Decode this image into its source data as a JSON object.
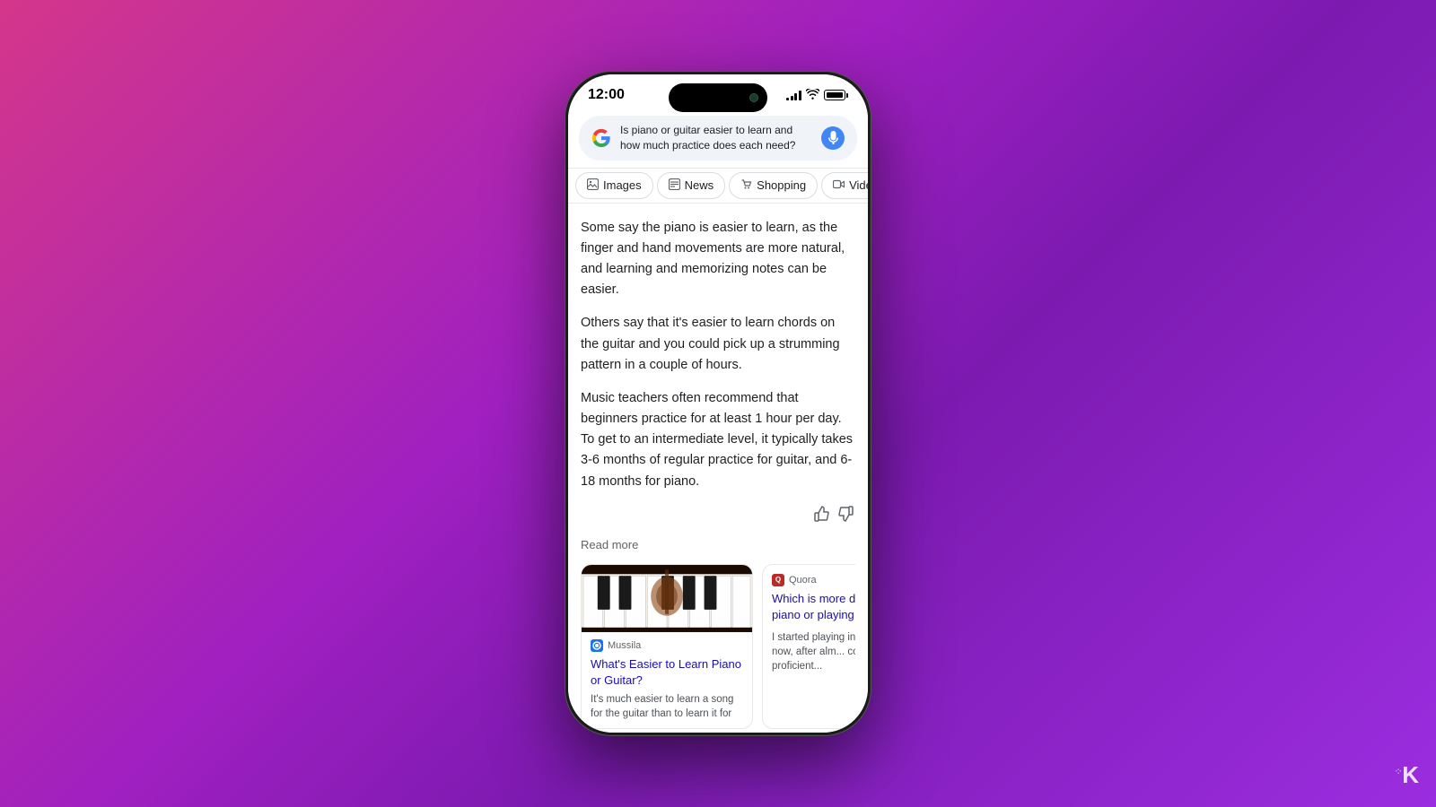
{
  "phone": {
    "status_bar": {
      "time": "12:00",
      "signal_label": "signal",
      "wifi_label": "wifi",
      "battery_label": "battery"
    },
    "search_bar": {
      "query": "Is piano or guitar easier to learn and how much practice does each need?",
      "mic_label": "microphone"
    },
    "tabs": [
      {
        "id": "images",
        "icon": "🖼",
        "label": "Images"
      },
      {
        "id": "news",
        "icon": "📰",
        "label": "News"
      },
      {
        "id": "shopping",
        "icon": "🛍",
        "label": "Shopping"
      },
      {
        "id": "videos",
        "icon": "▶",
        "label": "Vide..."
      }
    ],
    "answer": {
      "paragraph1": "Some say the piano is easier to learn, as the finger and hand movements are more natural, and learning and memorizing notes can be easier.",
      "paragraph2": "Others say that it's easier to learn chords on the guitar and you could pick up a strumming pattern in a couple of hours.",
      "paragraph3": "Music teachers often recommend that beginners practice for at least 1 hour per day. To get to an intermediate level, it typically takes 3-6 months of regular practice for guitar, and 6-18 months for piano.",
      "read_more": "Read more",
      "thumbs_up": "👍",
      "thumbs_down": "👎"
    },
    "cards": [
      {
        "id": "mussila",
        "source_name": "Mussila",
        "title": "What's Easier to Learn Piano or Guitar?",
        "snippet": "It's much easier to learn a song for the guitar than to learn it for",
        "has_image": true
      },
      {
        "id": "quora",
        "source_name": "Quora",
        "title": "Which is more difficult, playing piano or playing guitar",
        "snippet": "I started playing instruments th... now, after alm... continue to d... proficient..."
      }
    ]
  },
  "watermark": {
    "prefix": "·:·",
    "letter": "K"
  }
}
